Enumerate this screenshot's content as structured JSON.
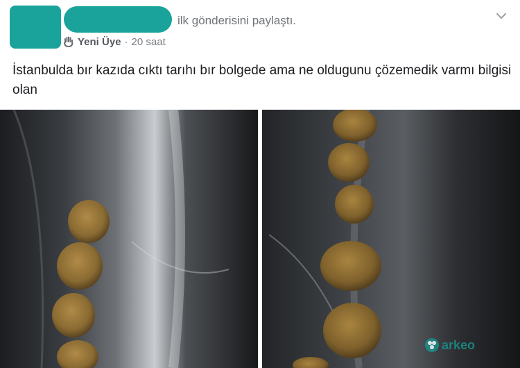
{
  "post": {
    "action_text": "ilk gönderisini paylaştı.",
    "role_badge": "Yeni Üye",
    "separator": "·",
    "time_ago": "20 saat",
    "body_text": "İstanbulda bır kazıda cıktı tarıhı bır bolgede ama ne oldugunu çözemedik varmı bilgisi olan"
  },
  "icons": {
    "role": "hand-icon",
    "menu": "chevron-down-icon",
    "watermark": "flower-logo-icon"
  },
  "colors": {
    "redaction": "#19a39a",
    "text": "#1c1e21",
    "muted": "#7a7e83",
    "coin": "#8a6b32"
  },
  "watermark": {
    "text": "arkeo"
  }
}
